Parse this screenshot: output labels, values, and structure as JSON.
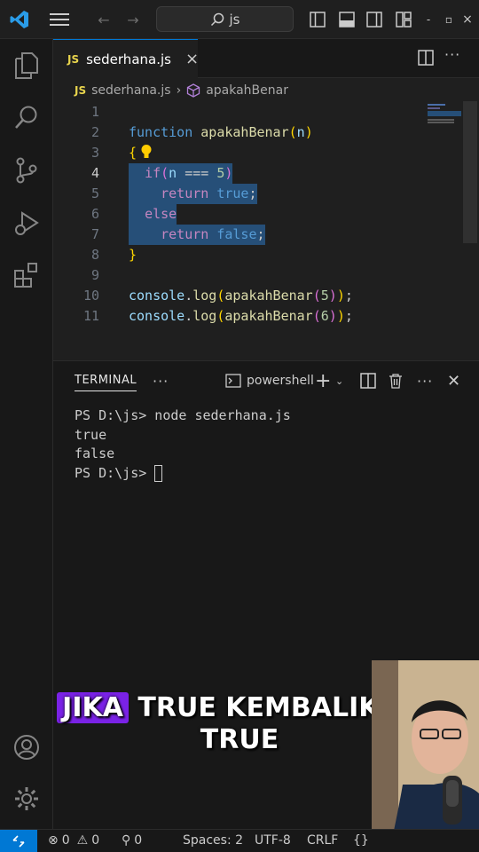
{
  "titlebar": {
    "search_text": "js",
    "icons": [
      "vscode-logo-icon",
      "menu-icon",
      "back-arrow-icon",
      "forward-arrow-icon",
      "search-icon",
      "toggle-sidebar-icon",
      "toggle-panel-icon",
      "toggle-secondary-sidebar-icon",
      "customize-layout-icon",
      "minimize-icon",
      "restore-icon",
      "close-icon"
    ],
    "window_minimize": "-",
    "window_restore": "▫",
    "window_close": "×"
  },
  "tab": {
    "badge": "JS",
    "label": "sederhana.js"
  },
  "breadcrumb": {
    "file_badge": "JS",
    "file": "sederhana.js",
    "symbol": "apakahBenar"
  },
  "editor": {
    "line_numbers": [
      "1",
      "2",
      "3",
      "4",
      "5",
      "6",
      "7",
      "8",
      "9",
      "10",
      "11"
    ],
    "lines": {
      "l2": {
        "kw": "function",
        "fn": "apakahBenar",
        "open": "(",
        "param": "n",
        "close": ")"
      },
      "l3": {
        "brace": "{"
      },
      "l4": {
        "kw": "if",
        "open": "(",
        "param": "n",
        "op": " === ",
        "num": "5",
        "close": ")"
      },
      "l5": {
        "kw": "return",
        "val": "true",
        "end": ";"
      },
      "l6": {
        "kw": "else"
      },
      "l7": {
        "kw": "return",
        "val": "false",
        "end": ";"
      },
      "l8": {
        "brace": "}"
      },
      "l10": {
        "obj": "console",
        "dot": ".",
        "method": "log",
        "open": "(",
        "fn": "apakahBenar",
        "open2": "(",
        "num": "5",
        "close2": ")",
        "close": ")",
        "end": ";"
      },
      "l11": {
        "obj": "console",
        "dot": ".",
        "method": "log",
        "open": "(",
        "fn": "apakahBenar",
        "open2": "(",
        "num": "6",
        "close2": ")",
        "close": ")",
        "end": ";"
      }
    }
  },
  "panel": {
    "tab_label": "TERMINAL",
    "more": "···",
    "shell": "powershell",
    "terminal_lines": [
      "PS D:\\js> node sederhana.js",
      "true",
      "false",
      "PS D:\\js> "
    ]
  },
  "statusbar": {
    "errors": "0",
    "warnings": "0",
    "ports": "0",
    "spaces": "Spaces: 2",
    "encoding": "UTF-8",
    "eol": "CRLF",
    "lang": "{}"
  },
  "caption": {
    "highlight": "JIKA",
    "rest": "TRUE KEMBALIKAN",
    "line2": "TRUE"
  },
  "colors": {
    "accent": "#0078d4",
    "caption_highlight": "#7a22e6",
    "selection": "#264f78"
  }
}
